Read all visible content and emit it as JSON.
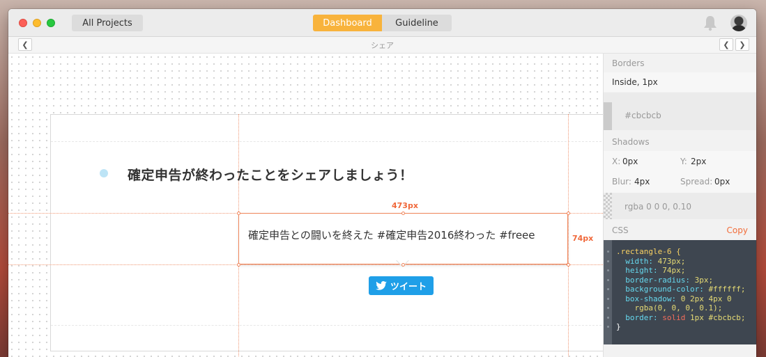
{
  "window": {
    "all_projects_label": "All Projects",
    "tabs": [
      {
        "label": "Dashboard",
        "active": true
      },
      {
        "label": "Guideline",
        "active": false
      }
    ],
    "icons": [
      "close-dot",
      "minimize-dot",
      "maximize-dot",
      "bell-icon",
      "avatar"
    ]
  },
  "subbar": {
    "title": "シェア"
  },
  "canvas": {
    "headline": "確定申告が終わったことをシェアしましょう！",
    "tweet_text": "確定申告との闘いを終えた #確定申告2016終わった #freee",
    "tweet_button_label": "ツイート",
    "width_label": "473px",
    "height_label": "74px",
    "accent_color": "#f0855a",
    "tweet_color": "#1f9fe8"
  },
  "panel": {
    "borders_header": "Borders",
    "borders_value": "Inside, 1px",
    "border_color": "#cbcbcb",
    "shadows_header": "Shadows",
    "shadow_x_label": "X:",
    "shadow_x": "0px",
    "shadow_y_label": "Y:",
    "shadow_y": "2px",
    "shadow_blur_label": "Blur:",
    "shadow_blur": "4px",
    "shadow_spread_label": "Spread:",
    "shadow_spread": "0px",
    "shadow_color": "rgba 0 0 0, 0.10",
    "css_header": "CSS",
    "copy_label": "Copy",
    "code": {
      "l1": ".rectangle-6 {",
      "l2_prop": "width:",
      "l2_val": "473px;",
      "l3_prop": "height:",
      "l3_val": "74px;",
      "l4_prop": "border-radius:",
      "l4_val": "3px;",
      "l5_prop": "background-color:",
      "l5_val": "#ffffff;",
      "l6_prop": "box-shadow:",
      "l6_val": "0 2px 4px 0",
      "l7": "rgba(0, 0, 0, 0.1);",
      "l8_prop": "border:",
      "l8_kw": "solid",
      "l8_val": "1px #cbcbcb;",
      "l9": "}"
    }
  }
}
